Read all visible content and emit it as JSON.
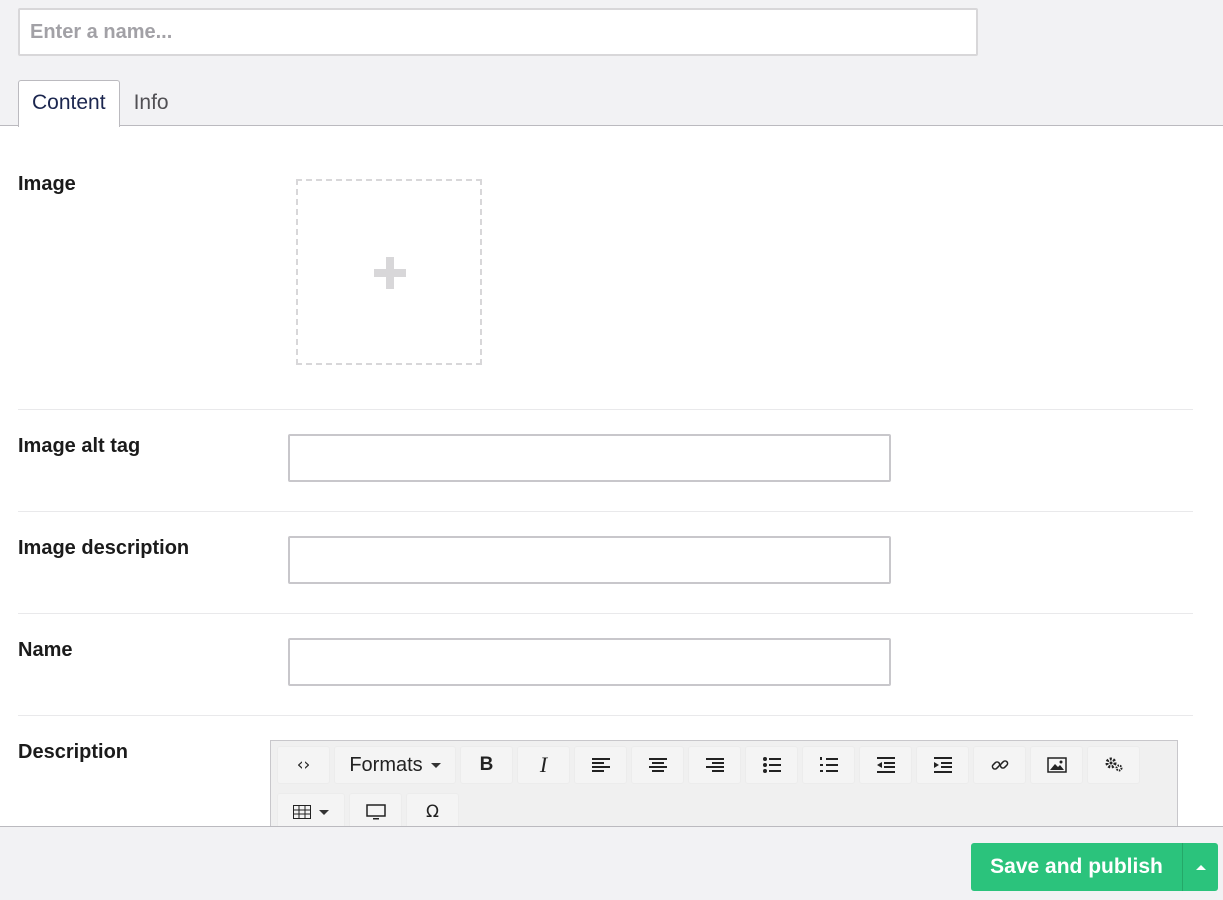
{
  "header": {
    "name_placeholder": "Enter a name...",
    "name_value": ""
  },
  "tabs": [
    {
      "label": "Content",
      "active": true
    },
    {
      "label": "Info",
      "active": false
    }
  ],
  "properties": {
    "image": {
      "label": "Image"
    },
    "alt_tag": {
      "label": "Image alt tag",
      "value": ""
    },
    "image_description": {
      "label": "Image description",
      "value": ""
    },
    "name": {
      "label": "Name",
      "value": ""
    },
    "description": {
      "label": "Description"
    }
  },
  "rte_toolbar": {
    "formats_label": "Formats",
    "bold_label": "B",
    "italic_label": "I",
    "code_label": "‹›",
    "special_char_label": "Ω"
  },
  "footer": {
    "save_publish_label": "Save and publish"
  },
  "colors": {
    "primary_green": "#2bc37c",
    "background": "#f2f2f4",
    "border": "#d8d7d9"
  }
}
